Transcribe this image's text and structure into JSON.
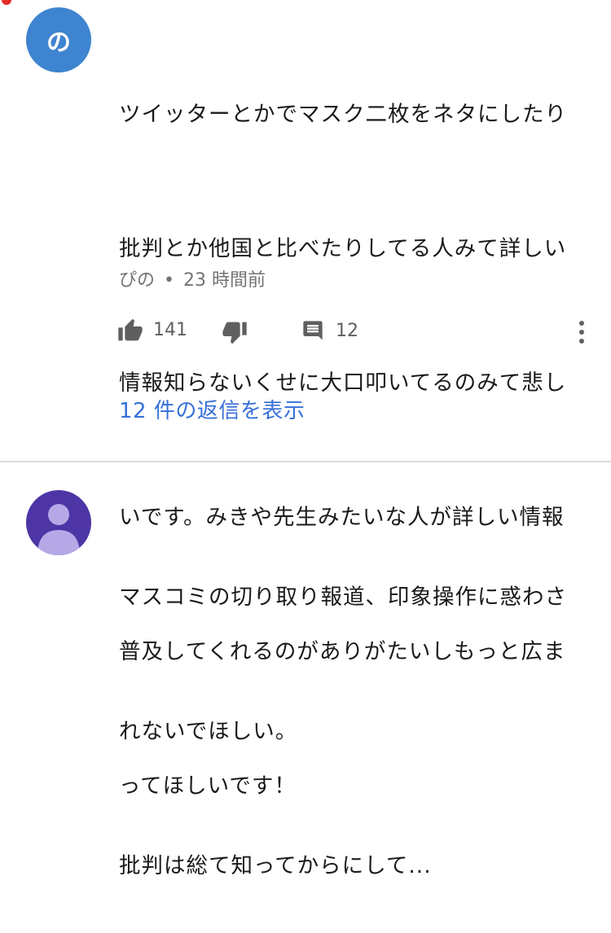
{
  "comment1": {
    "avatar_letter": "の",
    "text_lines": [
      "ツイッターとかでマスク二枚をネタにしたり",
      "批判とか他国と比べたりしてる人みて詳しい",
      "情報知らないくせに大口叩いてるのみて悲し",
      "いです。みきや先生みたいな人が詳しい情報",
      "普及してくれるのがありがたいしもっと広ま",
      "ってほしいです！"
    ],
    "author": "ぴの",
    "separator": "•",
    "timestamp": "23 時間前",
    "like_count": "141",
    "reply_count": "12",
    "view_replies_label": "12 件の返信を表示"
  },
  "comment2": {
    "text_lines": [
      "マスコミの切り取り報道、印象操作に惑わさ",
      "れないでほしい。",
      "批判は総て知ってからにして..."
    ]
  },
  "colors": {
    "avatar_blue": "#3e84d0",
    "avatar_purple": "#4d35a5",
    "link_blue": "#3670d8",
    "icon_gray": "#5f5f5f"
  },
  "icons": [
    "thumbs-up-icon",
    "thumbs-down-icon",
    "reply-comment-icon",
    "more-vert-icon",
    "default-user-icon"
  ]
}
